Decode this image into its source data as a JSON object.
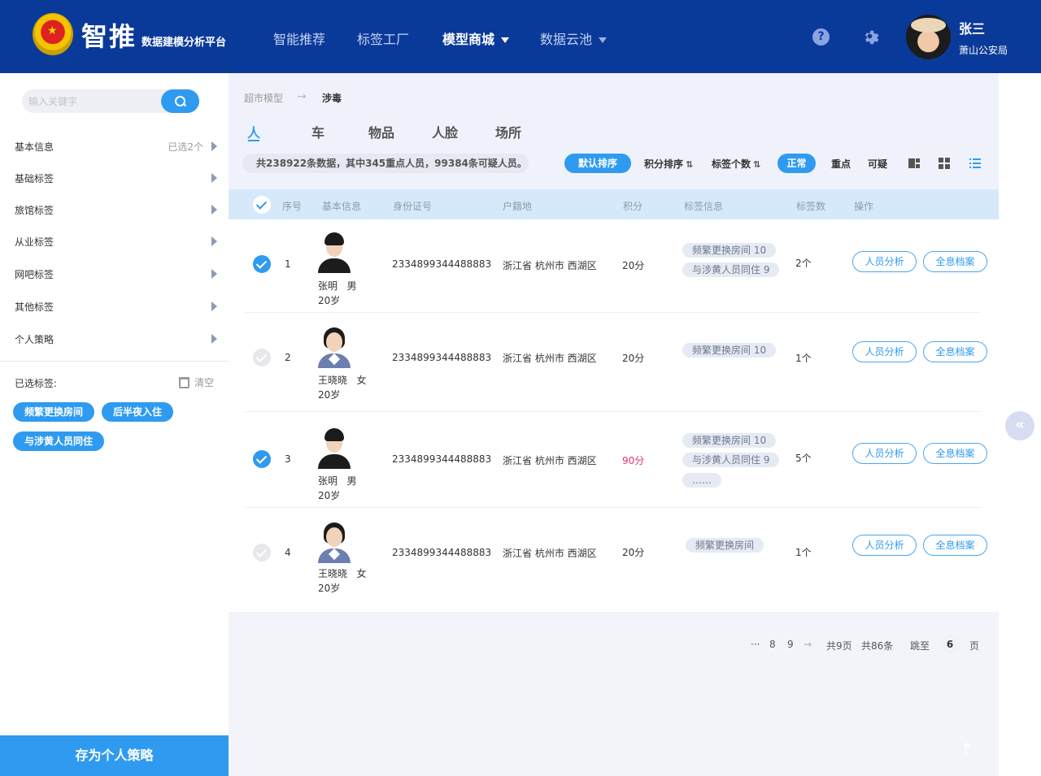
{
  "header": {
    "brand_title": "智推",
    "brand_subtitle": "数据建模分析平台",
    "nav": [
      {
        "label": "智能推荐"
      },
      {
        "label": "标签工厂"
      },
      {
        "label": "模型商城"
      },
      {
        "label": "数据云池"
      }
    ],
    "help_icon": "?",
    "user_name": "张三",
    "user_org": "萧山公安局"
  },
  "sidebar": {
    "search_placeholder": "输入关键字",
    "menu": [
      {
        "label": "基本信息",
        "extra": "已选2个"
      },
      {
        "label": "基础标签"
      },
      {
        "label": "旅馆标签"
      },
      {
        "label": "从业标签"
      },
      {
        "label": "网吧标签"
      },
      {
        "label": "其他标签"
      },
      {
        "label": "个人策略"
      }
    ],
    "selected_title": "已选标签:",
    "clear_label": "清空",
    "chips": [
      "频繁更换房间",
      "后半夜入住",
      "与涉黄人员同住"
    ],
    "save_label": "存为个人策略"
  },
  "breadcrumb": {
    "parent": "超市模型",
    "current": "涉毒"
  },
  "tabs": [
    "人",
    "车",
    "物品",
    "人脸",
    "场所"
  ],
  "toolbar": {
    "summary": "共238922条数据，其中345重点人员，99384条可疑人员。",
    "default_sort": "默认排序",
    "score_sort": "积分排序",
    "tag_count_sort": "标签个数",
    "sort_icon": "⇅",
    "filter_normal": "正常",
    "filter_key": "重点",
    "filter_suspect": "可疑"
  },
  "table": {
    "headers": {
      "index": "序号",
      "basic": "基本信息",
      "id": "身份证号",
      "household": "户籍地",
      "score": "积分",
      "tags": "标签信息",
      "tag_count": "标签数",
      "ops": "操作"
    },
    "rows": [
      {
        "index": "1",
        "checked": true,
        "name_line": "张明   男",
        "age": "20岁",
        "id": "2334899344488883",
        "household": "浙江省 杭州市 西湖区",
        "score": "20分",
        "tags": [
          "频繁更换房间 10",
          "与涉黄人员同住 9"
        ],
        "tag_count": "2个"
      },
      {
        "index": "2",
        "checked": false,
        "name_line": "王晓晓   女",
        "age": "20岁",
        "id": "2334899344488883",
        "household": "浙江省 杭州市 西湖区",
        "score": "20分",
        "tags": [
          "频繁更换房间 10"
        ],
        "tag_count": "1个"
      },
      {
        "index": "3",
        "checked": true,
        "name_line": "张明   男",
        "age": "20岁",
        "id": "2334899344488883",
        "household": "浙江省 杭州市 西湖区",
        "score": "90分",
        "tags": [
          "频繁更换房间 10",
          "与涉黄人员同住 9",
          "……"
        ],
        "tag_count": "5个"
      },
      {
        "index": "4",
        "checked": false,
        "name_line": "王晓晓   女",
        "age": "20岁",
        "id": "2334899344488883",
        "household": "浙江省 杭州市 西湖区",
        "score": "20分",
        "tags": [
          "频繁更换房间"
        ],
        "tag_count": "1个"
      }
    ],
    "op_analysis": "人员分析",
    "op_archive": "全息档案"
  },
  "pager": {
    "ellipsis": "···",
    "page_a": "8",
    "page_b": "9",
    "next": "→",
    "total_pages": "共9页",
    "total_items": "共86条",
    "jump_label": "跳至",
    "jump_value": "6",
    "page_unit": "页"
  },
  "colors": {
    "header_bg": "#0a3a99",
    "accent": "#2f9bf0",
    "warning_score": "#e8336b"
  },
  "float": {
    "collapse": "«",
    "top": "↑"
  }
}
